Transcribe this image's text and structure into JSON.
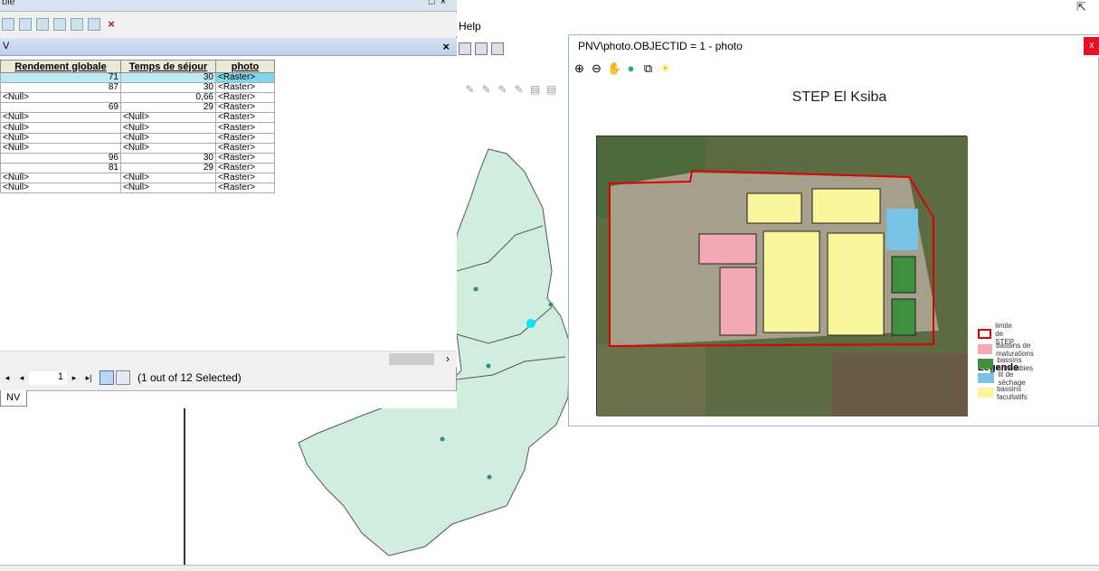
{
  "background": {
    "menu_help": "Help",
    "map_colors": {
      "polygon": "#cfeede",
      "polygon_stroke": "#555",
      "point": "#2b8c8c",
      "selected_point": "#00e5ff"
    }
  },
  "table_window": {
    "title": "ble",
    "tab_title": "V",
    "columns": [
      "Rendement globale",
      "Temps de séjour",
      "photo"
    ],
    "rows": [
      [
        "71",
        "30",
        "<Raster>"
      ],
      [
        "87",
        "30",
        "<Raster>"
      ],
      [
        "<Null>",
        "0,66",
        "<Raster>"
      ],
      [
        "69",
        "29",
        "<Raster>"
      ],
      [
        "<Null>",
        "<Null>",
        "<Raster>"
      ],
      [
        "<Null>",
        "<Null>",
        "<Raster>"
      ],
      [
        "<Null>",
        "<Null>",
        "<Raster>"
      ],
      [
        "<Null>",
        "<Null>",
        "<Raster>"
      ],
      [
        "96",
        "30",
        "<Raster>"
      ],
      [
        "81",
        "29",
        "<Raster>"
      ],
      [
        "<Null>",
        "<Null>",
        "<Raster>"
      ],
      [
        "<Null>",
        "<Null>",
        "<Raster>"
      ]
    ],
    "current_record": "1",
    "selection_status": "(1 out of 12 Selected)",
    "bottom_tab": "NV"
  },
  "photo_window": {
    "title": "PNV\\photo.OBJECTID = 1 - photo",
    "close_label": "x",
    "map_title": "STEP El Ksiba",
    "legend_title": "Légende",
    "legend": [
      {
        "label": "limite de STEP",
        "color": "#ffffff",
        "border": "#cc0000"
      },
      {
        "label": "bassins de maturations",
        "color": "#f4a8b4",
        "border": "#f4a8b4"
      },
      {
        "label": "bassins anaérobies",
        "color": "#3f8f3f",
        "border": "#3f8f3f"
      },
      {
        "label": "lit de séchage",
        "color": "#79c3e6",
        "border": "#79c3e6"
      },
      {
        "label": "bassins facultatifs",
        "color": "#fbf59c",
        "border": "#fbf59c"
      }
    ]
  }
}
